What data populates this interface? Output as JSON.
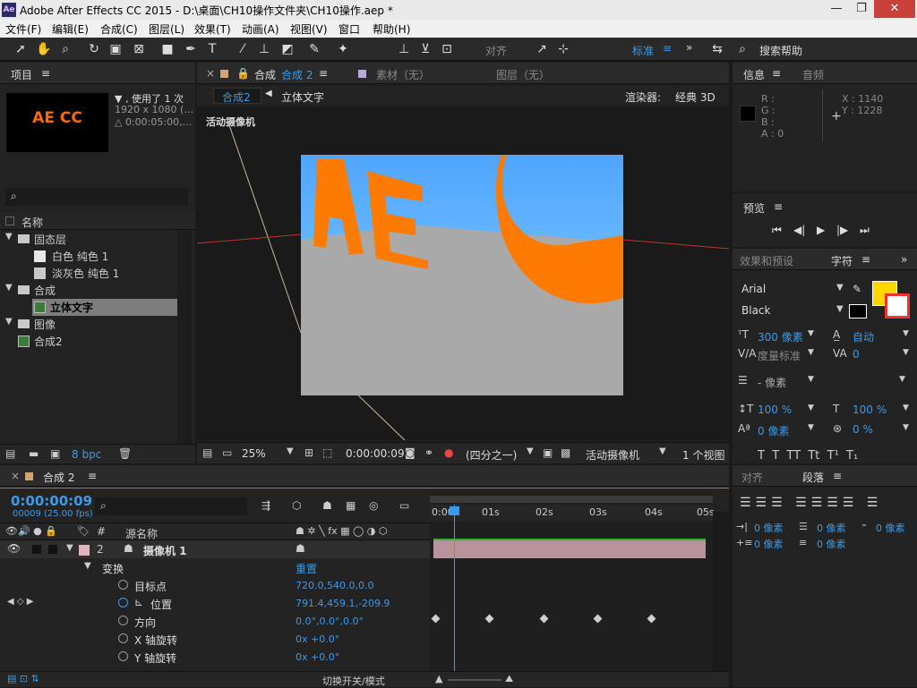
{
  "app": {
    "title": "Adobe After Effects CC 2015 - D:\\桌面\\CH10操作文件夹\\CH10操作.aep *",
    "icon_label": "Ae"
  },
  "window": {
    "minimize": "—",
    "restore": "❐",
    "close": "✕"
  },
  "menu": [
    "文件(F)",
    "编辑(E)",
    "合成(C)",
    "图层(L)",
    "效果(T)",
    "动画(A)",
    "视图(V)",
    "窗口",
    "帮助(H)"
  ],
  "toolbar": {
    "align_label": "对齐",
    "workspace": "标准",
    "search_help": "搜索帮助"
  },
  "project": {
    "title": "项目",
    "thumb_text": "AE CC",
    "info_line1": "▼ , 使用了 1 次",
    "info_line2": "1920 x 1080 (…",
    "info_line3": "△ 0:00:05:00,…",
    "search_placeholder": "",
    "col_name": "名称",
    "tree": [
      {
        "label": "固态层",
        "type": "folder",
        "expanded": true
      },
      {
        "label": "白色 纯色 1",
        "type": "solid",
        "color": "#e8e8e8"
      },
      {
        "label": "淡灰色 纯色 1",
        "type": "solid",
        "color": "#c8c8c8"
      },
      {
        "label": "合成",
        "type": "folder",
        "expanded": true
      },
      {
        "label": "立体文字",
        "type": "comp",
        "selected": true
      },
      {
        "label": "图像",
        "type": "folder",
        "expanded": true
      },
      {
        "label": "合成2",
        "type": "comp"
      }
    ],
    "bpc": "8 bpc"
  },
  "composition": {
    "tab_close": "×",
    "tab_title": "合成",
    "tab_name": "合成 2",
    "material_tab": "素材（无）",
    "layer_tab": "图层（无）",
    "breadcrumb_active": "合成2",
    "breadcrumb_next": "立体文字",
    "renderer_label": "渲染器:",
    "renderer_value": "经典 3D",
    "camera_label": "活动摄像机",
    "zoom": "25%",
    "timecode": "0:00:00:09",
    "resolution": "(四分之一)",
    "camera_view": "活动摄像机",
    "views": "1 个视图"
  },
  "info": {
    "tab": "信息",
    "tab2": "音频",
    "r": "R :",
    "g": "G :",
    "b": "B :",
    "a": "A : 0",
    "x": "X : 1140",
    "y": "Y : 1228"
  },
  "preview": {
    "tab": "预览"
  },
  "character": {
    "tab_effects": "效果和预设",
    "tab": "字符",
    "font": "Arial",
    "style": "Black",
    "size": "300 像素",
    "leading": "自动",
    "kerning": "度量标准",
    "tracking": "0",
    "stroke": "- 像素",
    "v_scale": "100 %",
    "h_scale": "100 %",
    "baseline": "0 像素",
    "tsume": "0 %",
    "fill_color": "#ffd700"
  },
  "paragraph": {
    "tab_align": "对齐",
    "tab": "段落",
    "indent_left": "0 像素",
    "indent_right": "0 像素",
    "indent_first": "0 像素",
    "space_before": "0 像素",
    "space_after": "0 像素"
  },
  "timeline": {
    "tab_title": "合成 2",
    "timecode": "0:00:00:09",
    "frame_info": "00009 (25.00 fps)",
    "col_source": "源名称",
    "layer_num": "2",
    "layer_name": "摄像机 1",
    "transform": "变换",
    "reset": "重置",
    "props": [
      {
        "name": "目标点",
        "value": "720.0,540.0,0.0"
      },
      {
        "name": "位置",
        "value": "791.4,459.1,-209.9"
      },
      {
        "name": "方向",
        "value": "0.0°,0.0°,0.0°"
      },
      {
        "name": "X 轴旋转",
        "value": "0x +0.0°"
      },
      {
        "name": "Y 轴旋转",
        "value": "0x +0.0°"
      }
    ],
    "ruler": [
      "0:00s",
      "01s",
      "02s",
      "03s",
      "04s",
      "05s"
    ],
    "toggle_label": "切换开关/模式"
  }
}
